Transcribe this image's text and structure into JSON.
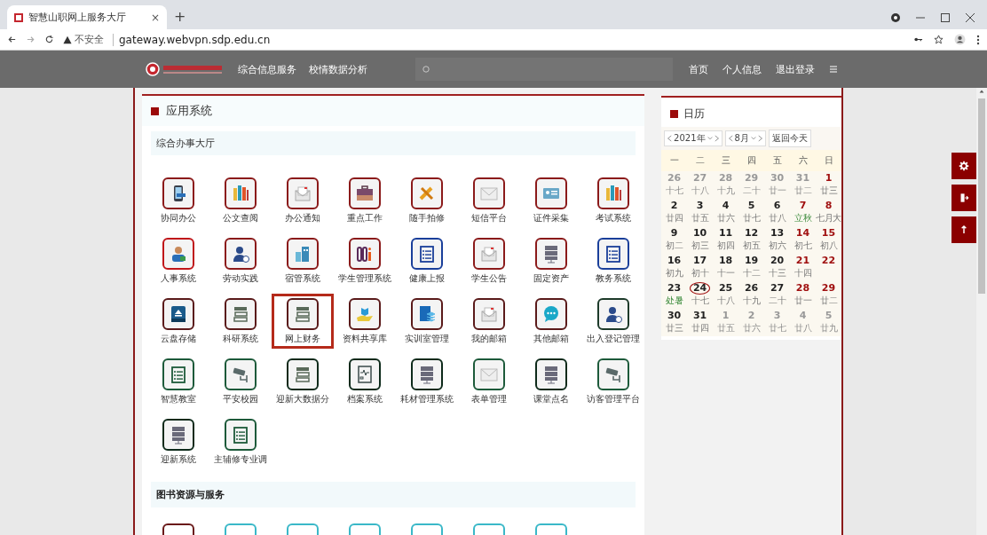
{
  "browser": {
    "tab": {
      "title": "智慧山职网上服务大厅",
      "close": "×"
    },
    "new_tab": "+",
    "security": "不安全",
    "url": "gateway.webvpn.sdp.edu.cn"
  },
  "header": {
    "nav": [
      "综合信息服务",
      "校情数据分析"
    ],
    "right": [
      "首页",
      "个人信息",
      "退出登录"
    ]
  },
  "apps": {
    "title": "应用系统",
    "group": "综合办事大厅",
    "items": [
      {
        "label": "协同办公",
        "kind": "phone",
        "color": "#8b1a1a",
        "selected": false
      },
      {
        "label": "公文查阅",
        "kind": "books",
        "color": "#8b1a1a",
        "selected": false
      },
      {
        "label": "办公通知",
        "kind": "letter",
        "color": "#8b1a1a",
        "selected": false
      },
      {
        "label": "重点工作",
        "kind": "briefcase",
        "color": "#8b1a1a",
        "selected": false
      },
      {
        "label": "随手拍修",
        "kind": "wrench",
        "color": "#8b1a1a",
        "selected": false
      },
      {
        "label": "短信平台",
        "kind": "envelope",
        "color": "#8b1a1a",
        "selected": false
      },
      {
        "label": "证件采集",
        "kind": "card",
        "color": "#8b1a1a",
        "selected": false
      },
      {
        "label": "考试系统",
        "kind": "books",
        "color": "#8b1a1a",
        "selected": false
      },
      {
        "label": "人事系统",
        "kind": "person",
        "color": "#c0161a",
        "selected": false
      },
      {
        "label": "劳动实践",
        "kind": "clockperson",
        "color": "#8b1a1a",
        "selected": false
      },
      {
        "label": "宿管系统",
        "kind": "building",
        "color": "#8b1a1a",
        "selected": false
      },
      {
        "label": "学生管理系统",
        "kind": "binders",
        "color": "#8b1a1a",
        "selected": false
      },
      {
        "label": "健康上报",
        "kind": "list",
        "color": "#1a3f9a",
        "selected": false
      },
      {
        "label": "学生公告",
        "kind": "letter",
        "color": "#8b1a1a",
        "selected": false
      },
      {
        "label": "固定资产",
        "kind": "server",
        "color": "#8b1a1a",
        "selected": false
      },
      {
        "label": "教务系统",
        "kind": "list",
        "color": "#1a3f9a",
        "selected": false
      },
      {
        "label": "云盘存储",
        "kind": "drive",
        "color": "#5a1a1a",
        "selected": false
      },
      {
        "label": "科研系统",
        "kind": "stack",
        "color": "#5a1a1a",
        "selected": false
      },
      {
        "label": "网上财务",
        "kind": "stack",
        "color": "#5a1a1a",
        "selected": true
      },
      {
        "label": "资料共享库",
        "kind": "handbook",
        "color": "#5a1a1a",
        "selected": false
      },
      {
        "label": "实训室管理",
        "kind": "docs",
        "color": "#5a1a1a",
        "selected": false
      },
      {
        "label": "我的邮箱",
        "kind": "letter",
        "color": "#5a1a1a",
        "selected": false
      },
      {
        "label": "其他邮箱",
        "kind": "chat",
        "color": "#5a1a1a",
        "selected": false
      },
      {
        "label": "出入登记管理",
        "kind": "clockperson",
        "color": "#1d3a2a",
        "selected": false
      },
      {
        "label": "智慧教室",
        "kind": "list",
        "color": "#1d5a3a",
        "selected": false
      },
      {
        "label": "平安校园",
        "kind": "camera",
        "color": "#1d5a3a",
        "selected": false
      },
      {
        "label": "迎新大数据分",
        "kind": "stack",
        "color": "#0d2a1a",
        "selected": false
      },
      {
        "label": "档案系统",
        "kind": "monitor",
        "color": "#0d2a1a",
        "selected": false
      },
      {
        "label": "耗材管理系统",
        "kind": "server",
        "color": "#0d2a1a",
        "selected": false
      },
      {
        "label": "表单管理",
        "kind": "envelope",
        "color": "#1d5a3a",
        "selected": false
      },
      {
        "label": "课堂点名",
        "kind": "server",
        "color": "#0d2a1a",
        "selected": false
      },
      {
        "label": "访客管理平台",
        "kind": "camera",
        "color": "#1d5a3a",
        "selected": false
      },
      {
        "label": "迎新系统",
        "kind": "server",
        "color": "#0d2a1a",
        "selected": false
      },
      {
        "label": "主辅修专业调",
        "kind": "list",
        "color": "#1d5a3a",
        "selected": false
      }
    ],
    "group2": "图书资源与服务",
    "group2_items": [
      {
        "color": "#6a1a1a"
      },
      {
        "color": "#3ab8c8"
      },
      {
        "color": "#3ab8c8"
      },
      {
        "color": "#3ab8c8"
      },
      {
        "color": "#3ab8c8"
      },
      {
        "color": "#3ab8c8"
      },
      {
        "color": "#3ab8c8"
      }
    ]
  },
  "calendar": {
    "title": "日历",
    "year": "2021年",
    "month": "8月",
    "today_button": "返回今天",
    "weekdays": [
      "一",
      "二",
      "三",
      "四",
      "五",
      "六",
      "日"
    ],
    "weeks": [
      [
        {
          "day": "26",
          "lunar": "十七",
          "other": true,
          "weekend": false,
          "today": false,
          "term": false
        },
        {
          "day": "27",
          "lunar": "十八",
          "other": true,
          "weekend": false,
          "today": false,
          "term": false
        },
        {
          "day": "28",
          "lunar": "十九",
          "other": true,
          "weekend": false,
          "today": false,
          "term": false
        },
        {
          "day": "29",
          "lunar": "二十",
          "other": true,
          "weekend": false,
          "today": false,
          "term": false
        },
        {
          "day": "30",
          "lunar": "廿一",
          "other": true,
          "weekend": false,
          "today": false,
          "term": false
        },
        {
          "day": "31",
          "lunar": "廿二",
          "other": true,
          "weekend": true,
          "today": false,
          "term": false
        },
        {
          "day": "1",
          "lunar": "廿三",
          "other": false,
          "weekend": true,
          "today": false,
          "term": false
        }
      ],
      [
        {
          "day": "2",
          "lunar": "廿四",
          "other": false,
          "weekend": false,
          "today": false,
          "term": false
        },
        {
          "day": "3",
          "lunar": "廿五",
          "other": false,
          "weekend": false,
          "today": false,
          "term": false
        },
        {
          "day": "4",
          "lunar": "廿六",
          "other": false,
          "weekend": false,
          "today": false,
          "term": false
        },
        {
          "day": "5",
          "lunar": "廿七",
          "other": false,
          "weekend": false,
          "today": false,
          "term": false
        },
        {
          "day": "6",
          "lunar": "廿八",
          "other": false,
          "weekend": false,
          "today": false,
          "term": false
        },
        {
          "day": "7",
          "lunar": "立秋",
          "other": false,
          "weekend": true,
          "today": false,
          "term": true
        },
        {
          "day": "8",
          "lunar": "七月大",
          "other": false,
          "weekend": true,
          "today": false,
          "term": false
        }
      ],
      [
        {
          "day": "9",
          "lunar": "初二",
          "other": false,
          "weekend": false,
          "today": false,
          "term": false
        },
        {
          "day": "10",
          "lunar": "初三",
          "other": false,
          "weekend": false,
          "today": false,
          "term": false
        },
        {
          "day": "11",
          "lunar": "初四",
          "other": false,
          "weekend": false,
          "today": false,
          "term": false
        },
        {
          "day": "12",
          "lunar": "初五",
          "other": false,
          "weekend": false,
          "today": false,
          "term": false
        },
        {
          "day": "13",
          "lunar": "初六",
          "other": false,
          "weekend": false,
          "today": false,
          "term": false
        },
        {
          "day": "14",
          "lunar": "初七",
          "other": false,
          "weekend": true,
          "today": false,
          "term": false
        },
        {
          "day": "15",
          "lunar": "初八",
          "other": false,
          "weekend": true,
          "today": false,
          "term": false
        }
      ],
      [
        {
          "day": "16",
          "lunar": "初九",
          "other": false,
          "weekend": false,
          "today": false,
          "term": false
        },
        {
          "day": "17",
          "lunar": "初十",
          "other": false,
          "weekend": false,
          "today": false,
          "term": false
        },
        {
          "day": "18",
          "lunar": "十一",
          "other": false,
          "weekend": false,
          "today": false,
          "term": false
        },
        {
          "day": "19",
          "lunar": "十二",
          "other": false,
          "weekend": false,
          "today": false,
          "term": false
        },
        {
          "day": "20",
          "lunar": "十三",
          "other": false,
          "weekend": false,
          "today": false,
          "term": false
        },
        {
          "day": "21",
          "lunar": "十四",
          "other": false,
          "weekend": true,
          "today": false,
          "term": false
        },
        {
          "day": "22",
          "other": false,
          "weekend": true,
          "today": false,
          "term": false
        }
      ],
      [
        {
          "day": "23",
          "lunar": "处暑",
          "other": false,
          "weekend": false,
          "today": false,
          "term": true
        },
        {
          "day": "24",
          "lunar": "十七",
          "other": false,
          "weekend": false,
          "today": true,
          "term": false
        },
        {
          "day": "25",
          "lunar": "十八",
          "other": false,
          "weekend": false,
          "today": false,
          "term": false
        },
        {
          "day": "26",
          "lunar": "十九",
          "other": false,
          "weekend": false,
          "today": false,
          "term": false
        },
        {
          "day": "27",
          "lunar": "二十",
          "other": false,
          "weekend": false,
          "today": false,
          "term": false
        },
        {
          "day": "28",
          "lunar": "廿一",
          "other": false,
          "weekend": true,
          "today": false,
          "term": false
        },
        {
          "day": "29",
          "lunar": "廿二",
          "other": false,
          "weekend": true,
          "today": false,
          "term": false
        }
      ],
      [
        {
          "day": "30",
          "lunar": "廿三",
          "other": false,
          "weekend": false,
          "today": false,
          "term": false
        },
        {
          "day": "31",
          "lunar": "廿四",
          "other": false,
          "weekend": false,
          "today": false,
          "term": false
        },
        {
          "day": "1",
          "lunar": "廿五",
          "other": true,
          "weekend": false,
          "today": false,
          "term": false
        },
        {
          "day": "2",
          "lunar": "廿六",
          "other": true,
          "weekend": false,
          "today": false,
          "term": false
        },
        {
          "day": "3",
          "lunar": "廿七",
          "other": true,
          "weekend": false,
          "today": false,
          "term": false
        },
        {
          "day": "4",
          "lunar": "廿八",
          "other": true,
          "weekend": true,
          "today": false,
          "term": false
        },
        {
          "day": "5",
          "lunar": "廿九",
          "other": true,
          "weekend": true,
          "today": false,
          "term": false
        }
      ]
    ]
  },
  "side_buttons": [
    {
      "kind": "gear"
    },
    {
      "kind": "exit"
    },
    {
      "kind": "up"
    }
  ]
}
